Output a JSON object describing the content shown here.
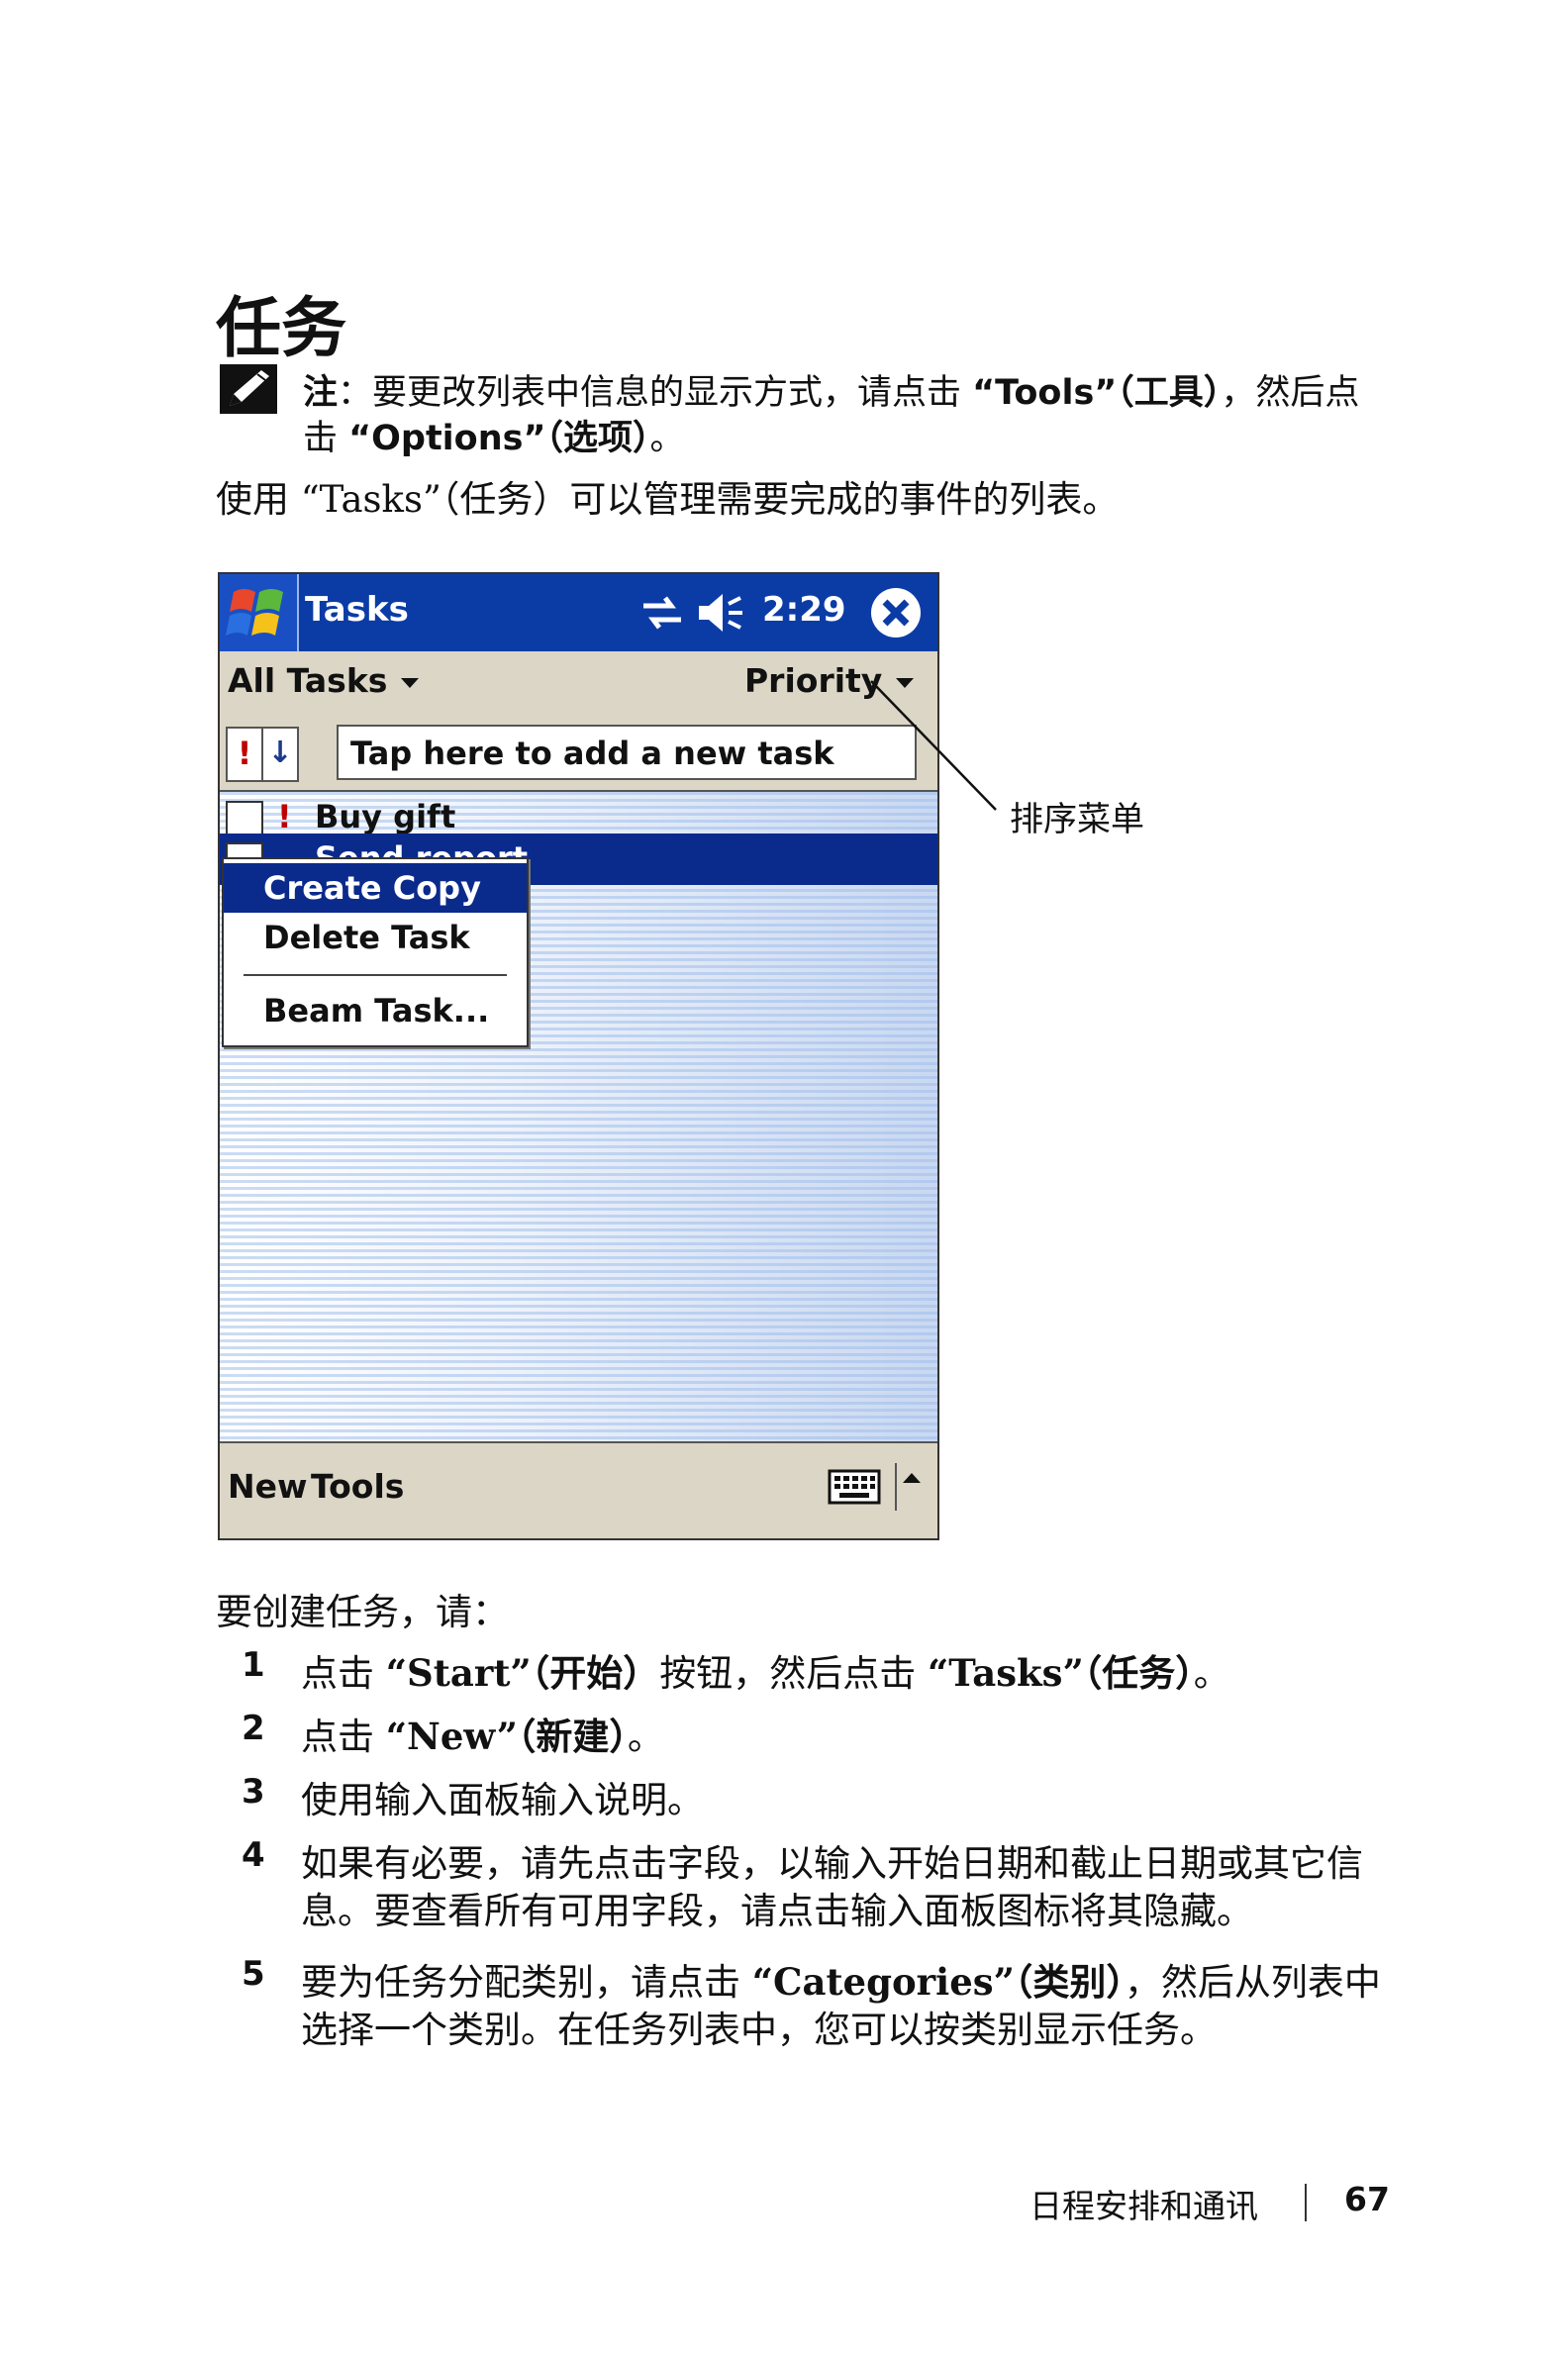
{
  "page_title": "任务",
  "note": {
    "label": "注",
    "line1_text": "：要更改列表中信息的显示方式，请点击 ",
    "tools": "“Tools”（工具）",
    "line1_end": "，然后点",
    "line2_start": "击 ",
    "options": "“Options”（选项）",
    "line2_end": "。"
  },
  "intro": "使用 “Tasks”（任务）可以管理需要完成的事件的列表。",
  "device": {
    "app_title": "Tasks",
    "clock": "2:29",
    "filter_label": "All Tasks",
    "sort_label": "Priority",
    "priority_column_symbol": "!",
    "sort_column_symbol": "↓",
    "new_task_placeholder": "Tap here to add a new task",
    "tasks": [
      {
        "label": "Buy gift",
        "priority": "!"
      },
      {
        "label": "Send report",
        "priority": ""
      }
    ],
    "context_menu": [
      "Create Copy",
      "Delete Task",
      "Beam Task..."
    ],
    "menubar": {
      "new": "New",
      "tools": "Tools"
    },
    "colors": {
      "title_bar": "#0b3ca6",
      "selection": "#0a2a8c",
      "chrome": "#dcd6c6",
      "priority": "#c00000"
    }
  },
  "callout_label": "排序菜单",
  "steps_intro": "要创建任务，请：",
  "steps": [
    {
      "num": "1",
      "a": "点击 ",
      "b1": "“Start”（开始）",
      "c": "按钮，然后点击 ",
      "b2": "“Tasks”（任务）",
      "d": "。"
    },
    {
      "num": "2",
      "a": "点击 ",
      "b1": "“New”（新建）",
      "d": "。"
    },
    {
      "num": "3",
      "text": "使用输入面板输入说明。"
    },
    {
      "num": "4",
      "line1": "如果有必要，请先点击字段，以输入开始日期和截止日期或其它信",
      "line2": "息。要查看所有可用字段，请点击输入面板图标将其隐藏。"
    },
    {
      "num": "5",
      "a": "要为任务分配类别，请点击 ",
      "b1": "“Categories”（类别）",
      "c": "，然后从列表中",
      "line2": "选择一个类别。在任务列表中，您可以按类别显示任务。"
    }
  ],
  "footer": {
    "section": "日程安排和通讯",
    "page": "67"
  }
}
